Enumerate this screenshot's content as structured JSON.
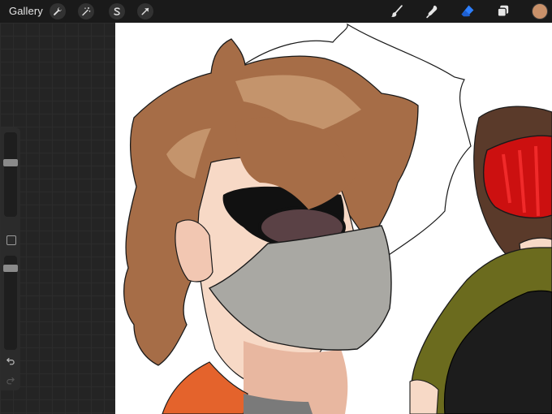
{
  "app": {
    "gallery_label": "Gallery"
  },
  "toolbar": {
    "left_tools": [
      "wrench-icon",
      "magic-wand-icon",
      "selection-icon",
      "transform-arrow-icon"
    ],
    "right_tools": [
      "brush-icon",
      "smudge-icon",
      "eraser-icon",
      "layers-icon"
    ],
    "active_tool": "eraser-icon",
    "active_color": "#c9916a",
    "accent_color": "#2d7fff"
  },
  "sidebar": {
    "brush_size_level": 0.35,
    "opacity_level": 0.1
  }
}
